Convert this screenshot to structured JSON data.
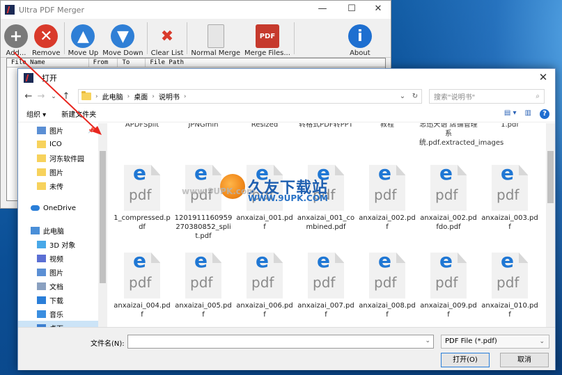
{
  "app": {
    "title": "Ultra PDF Merger",
    "toolbar": [
      {
        "label": "Add...",
        "icon": "add-icon",
        "color": "#7a7a7a",
        "glyph": "+"
      },
      {
        "label": "Remove",
        "icon": "remove-icon",
        "color": "#d93a2b",
        "glyph": "✕"
      },
      {
        "label": "Move Up",
        "icon": "arrow-up-icon",
        "color": "#2f7fd6",
        "glyph": "▲"
      },
      {
        "label": "Move Down",
        "icon": "arrow-down-icon",
        "color": "#2f7fd6",
        "glyph": "▼"
      },
      {
        "label": "Clear List",
        "icon": "broom-icon",
        "color": "#c9a24a",
        "glyph": "✖"
      },
      {
        "label": "Normal Merge",
        "icon": "document-icon",
        "color": "#e6e6e6",
        "glyph": ""
      },
      {
        "label": "Merge Files...",
        "icon": "pdf-merge-icon",
        "color": "#c63a2d",
        "glyph": "PDF"
      },
      {
        "label": "About",
        "icon": "info-icon",
        "color": "#1e6fd0",
        "glyph": "i"
      }
    ],
    "columns": [
      "File Name",
      "From",
      "To",
      "File Path"
    ]
  },
  "dialog": {
    "title": "打开",
    "breadcrumb": [
      "此电脑",
      "桌面",
      "说明书"
    ],
    "search_placeholder": "搜索\"说明书\"",
    "organize": "组织 ▾",
    "new_folder": "新建文件夹",
    "nav": [
      {
        "label": "图片",
        "type": "pictures",
        "pinned": true
      },
      {
        "label": "ICO",
        "type": "folder"
      },
      {
        "label": "河东软件园",
        "type": "folder"
      },
      {
        "label": "图片",
        "type": "folder"
      },
      {
        "label": "未传",
        "type": "folder"
      },
      {
        "label": "",
        "type": "spacer"
      },
      {
        "label": "OneDrive",
        "type": "onedrive"
      },
      {
        "label": "",
        "type": "spacer"
      },
      {
        "label": "此电脑",
        "type": "pc"
      },
      {
        "label": "3D 对象",
        "type": "3d"
      },
      {
        "label": "视频",
        "type": "video"
      },
      {
        "label": "图片",
        "type": "pictures"
      },
      {
        "label": "文档",
        "type": "docs"
      },
      {
        "label": "下载",
        "type": "download"
      },
      {
        "label": "音乐",
        "type": "music"
      },
      {
        "label": "桌面",
        "type": "desktop",
        "selected": true
      }
    ],
    "partial_row": [
      "APDFSplit",
      "JPNGmin",
      "Resized",
      "转格式PDF转PPT",
      "教程",
      "忠迅天语 店铺管理系统.pdf.extracted_images",
      "1.pdf"
    ],
    "files": [
      "1_compressed.pdf",
      "1201911160959270380852_split.pdf",
      "anxaizai_001.pdf",
      "anxaizai_001_combined.pdf",
      "anxaizai_002.pdf",
      "anxaizai_002.pdfdo.pdf",
      "anxaizai_003.pdf",
      "anxaizai_004.pdf",
      "anxaizai_005.pdf",
      "anxaizai_006.pdf",
      "anxaizai_007.pdf",
      "anxaizai_008.pdf",
      "anxaizai_009.pdf",
      "anxaizai_010.pdf"
    ],
    "filename_label": "文件名(N):",
    "filename_value": "",
    "filter": "PDF File (*.pdf)",
    "open_label": "打开(O)",
    "cancel_label": "取消"
  },
  "watermark": {
    "text": "久友下载站",
    "url": "www.9UPK.com",
    "url2": "WWW.9UPK.COM"
  }
}
